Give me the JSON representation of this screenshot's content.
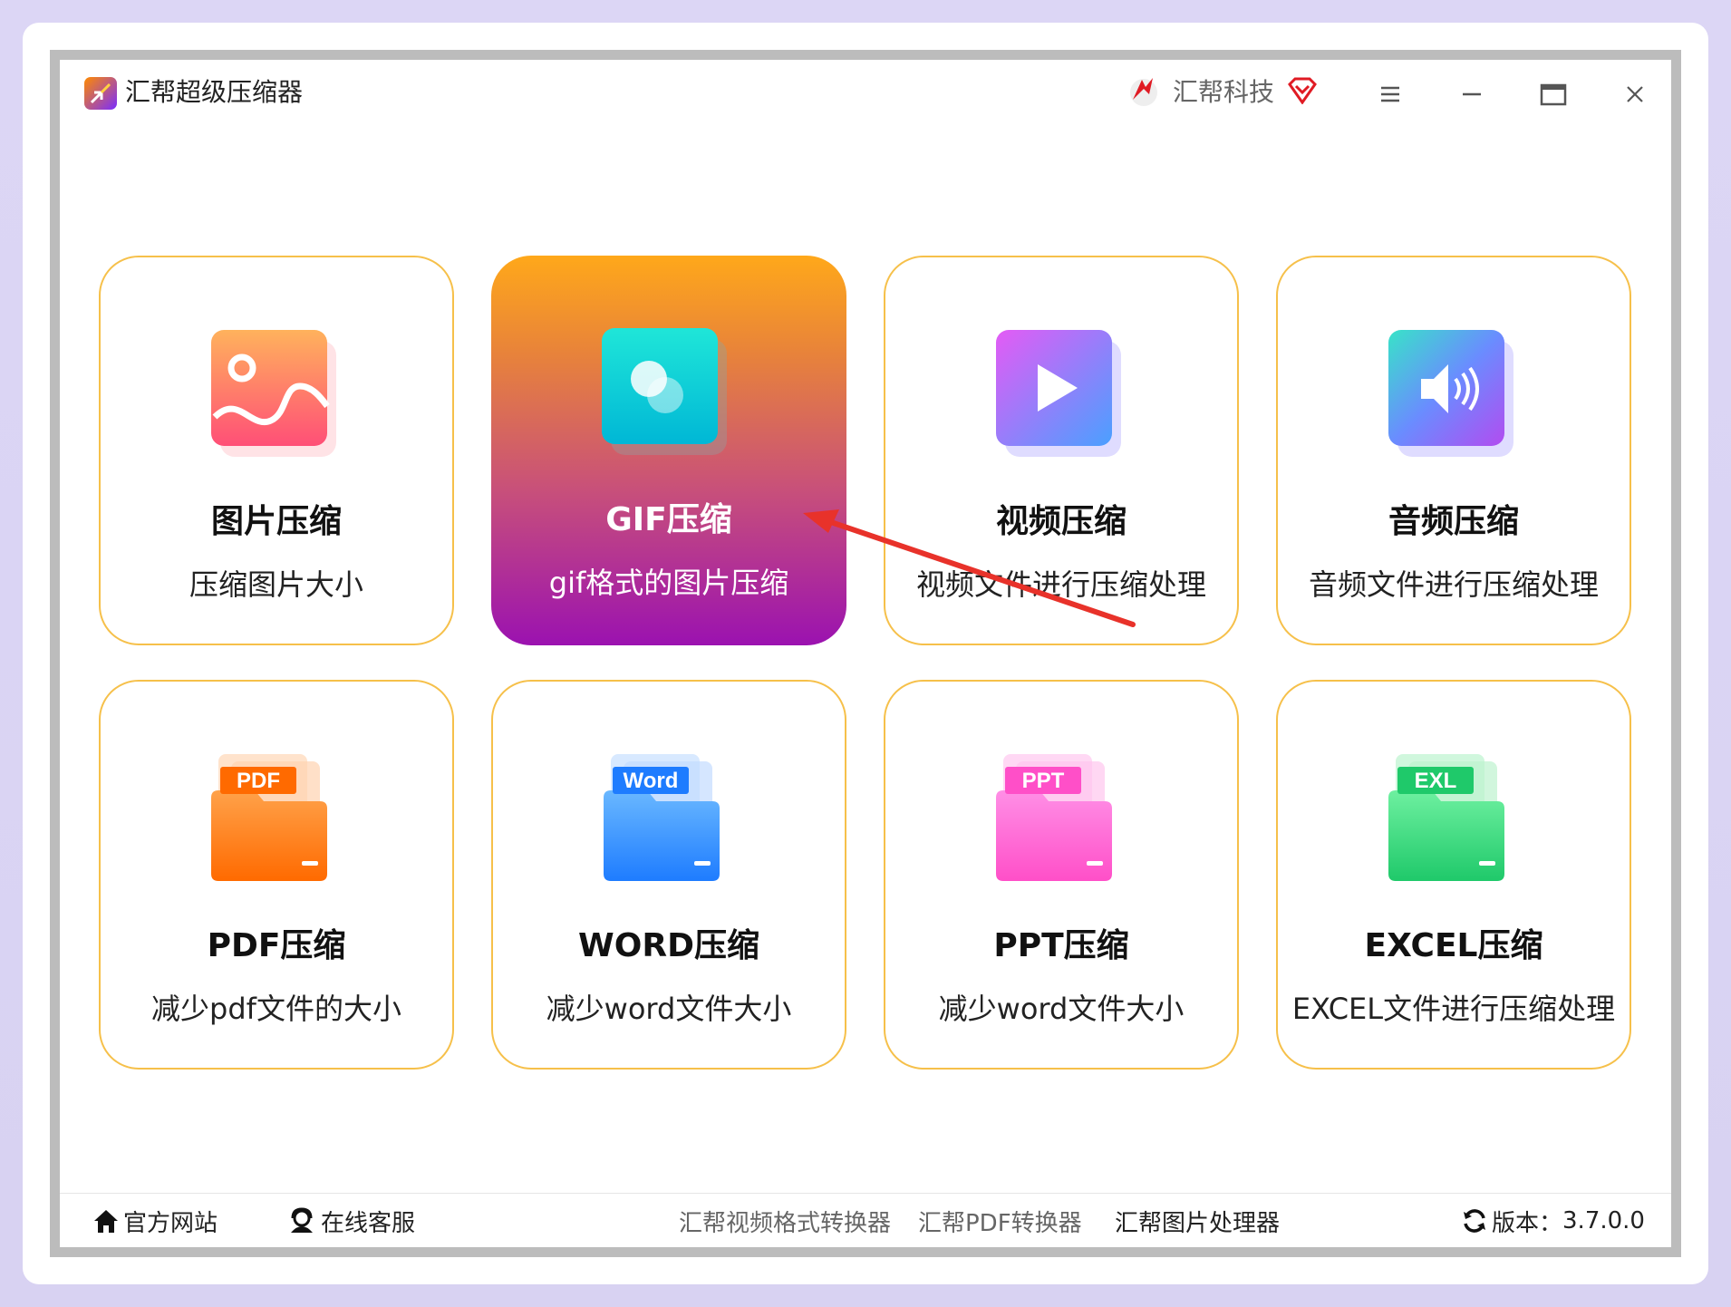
{
  "app": {
    "title": "汇帮超级压缩器",
    "brand": "汇帮科技"
  },
  "cards": [
    {
      "title": "图片压缩",
      "desc": "压缩图片大小",
      "icon": "image-icon"
    },
    {
      "title": "GIF压缩",
      "desc": "gif格式的图片压缩",
      "icon": "gif-icon"
    },
    {
      "title": "视频压缩",
      "desc": "视频文件进行压缩处理",
      "icon": "video-play-icon"
    },
    {
      "title": "音频压缩",
      "desc": "音频文件进行压缩处理",
      "icon": "audio-speaker-icon"
    },
    {
      "title": "PDF压缩",
      "desc": "减少pdf文件的大小",
      "icon": "pdf-folder-icon",
      "tag": "PDF"
    },
    {
      "title": "WORD压缩",
      "desc": "减少word文件大小",
      "icon": "word-folder-icon",
      "tag": "Word"
    },
    {
      "title": "PPT压缩",
      "desc": "减少word文件大小",
      "icon": "ppt-folder-icon",
      "tag": "PPT"
    },
    {
      "title": "EXCEL压缩",
      "desc": "EXCEL文件进行压缩处理",
      "icon": "excel-folder-icon",
      "tag": "EXL"
    }
  ],
  "footer": {
    "website": "官方网站",
    "service": "在线客服",
    "link_video": "汇帮视频格式转换器",
    "link_pdf": "汇帮PDF转换器",
    "link_image": "汇帮图片处理器",
    "version_label": "版本：",
    "version": "3.7.0.0"
  },
  "colors": {
    "accent_border": "#f6c04a",
    "active_top": "#ffa81a",
    "active_bottom": "#9b12b0",
    "annotation_arrow": "#e8322a"
  }
}
